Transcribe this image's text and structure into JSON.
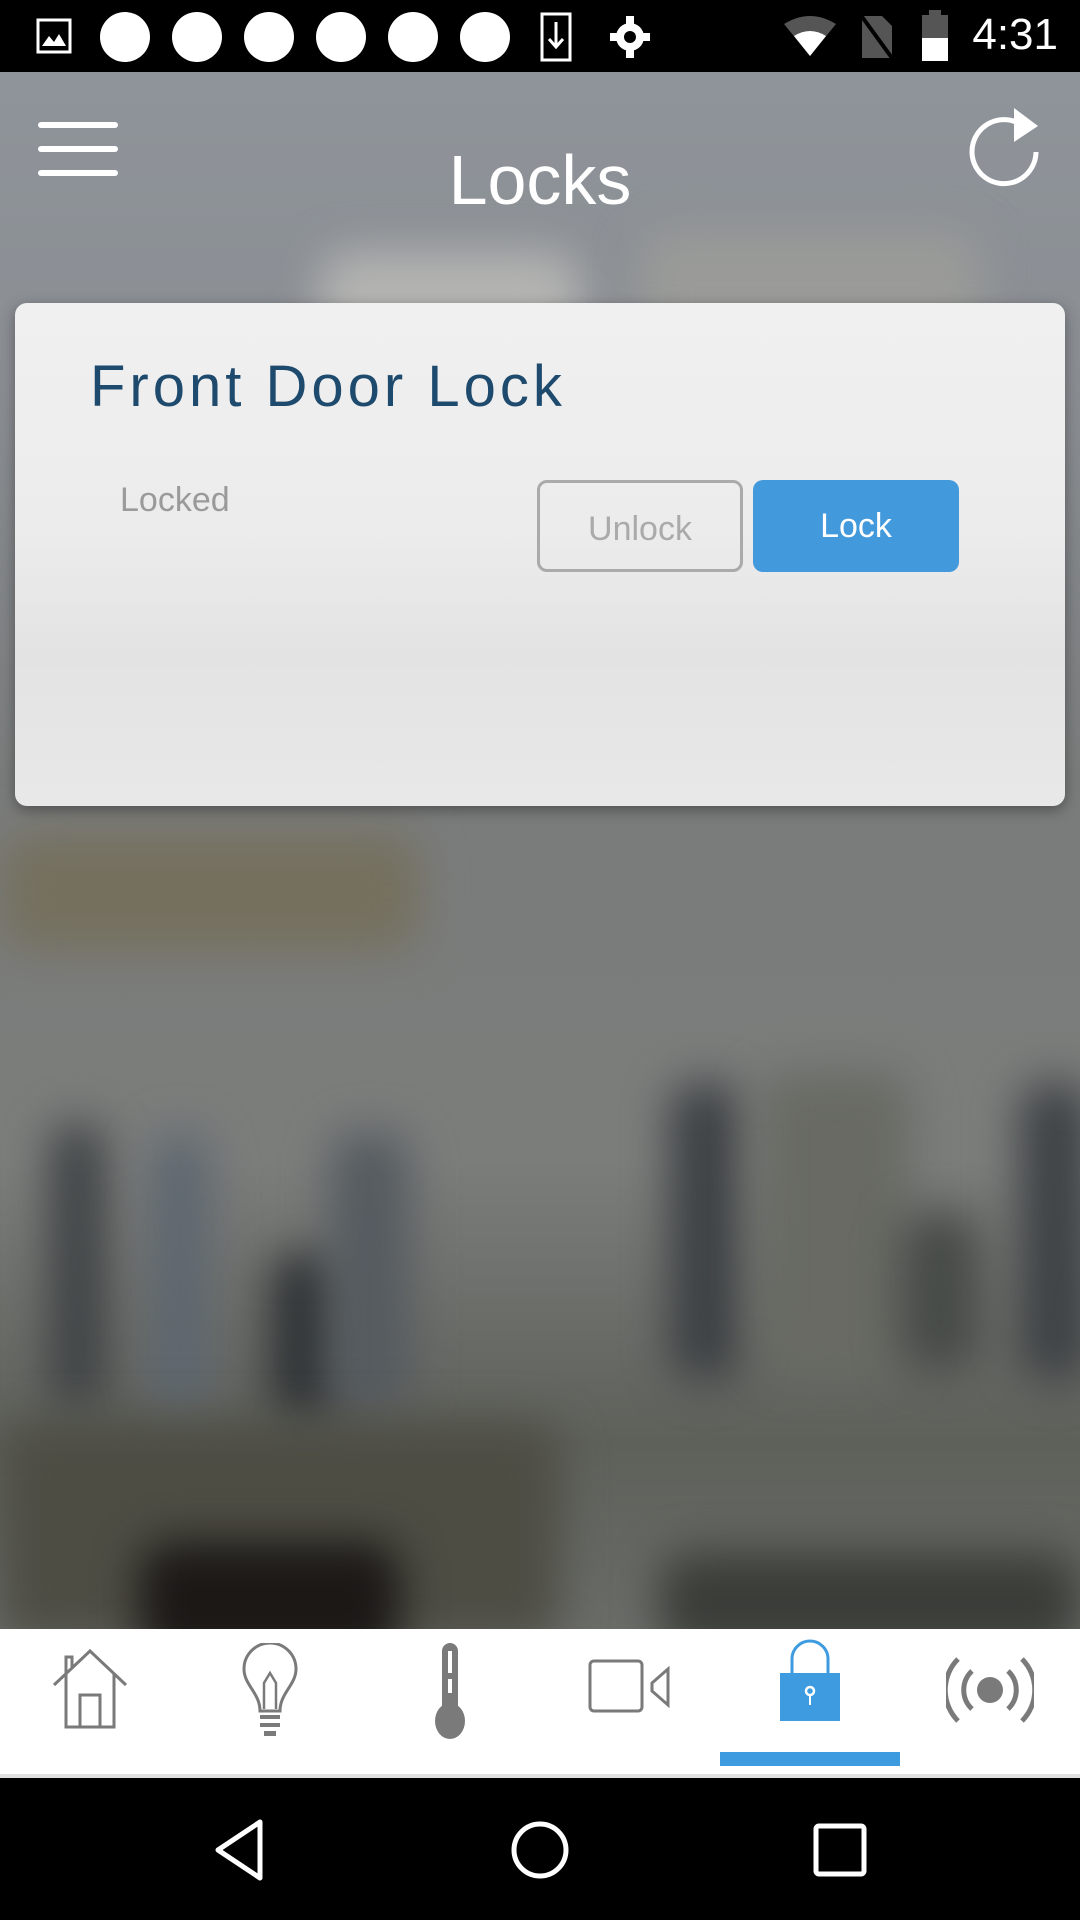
{
  "status_bar": {
    "time": "4:31",
    "left_icons": [
      "image-icon",
      "notification-dot",
      "notification-dot",
      "notification-dot",
      "notification-dot",
      "notification-dot",
      "notification-dot",
      "download-icon",
      "settings-cog-icon"
    ],
    "right_icons": [
      "wifi-icon",
      "no-sim-icon",
      "battery-icon"
    ]
  },
  "header": {
    "title": "Locks",
    "menu_icon": "hamburger-menu-icon",
    "refresh_icon": "refresh-icon"
  },
  "lock_card": {
    "name": "Front Door Lock",
    "status": "Locked",
    "unlock_label": "Unlock",
    "lock_label": "Lock"
  },
  "tabs": [
    {
      "name": "home",
      "icon": "house-icon",
      "active": false
    },
    {
      "name": "lights",
      "icon": "lightbulb-icon",
      "active": false
    },
    {
      "name": "thermostat",
      "icon": "thermometer-icon",
      "active": false
    },
    {
      "name": "cameras",
      "icon": "video-camera-icon",
      "active": false
    },
    {
      "name": "locks",
      "icon": "padlock-icon",
      "active": true
    },
    {
      "name": "sensors",
      "icon": "broadcast-icon",
      "active": false
    }
  ],
  "colors": {
    "accent": "#4299dc",
    "card_title": "#1e4a6e",
    "inactive_icon": "#7a7a7a"
  },
  "system_nav": [
    "back-button",
    "home-button",
    "recents-button"
  ]
}
